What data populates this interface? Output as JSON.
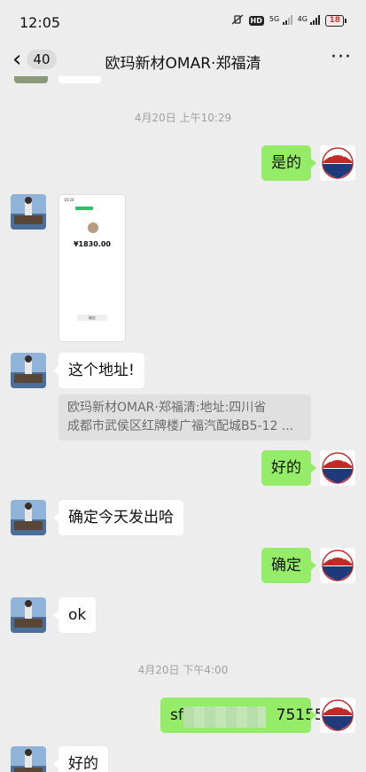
{
  "status_bar": {
    "time": "12:05",
    "hd": "HD",
    "net_a": "5G",
    "net_b": "4G",
    "battery": "18"
  },
  "nav": {
    "back_count": "40",
    "title": "欧玛新材OMAR·郑福清",
    "more": "···"
  },
  "timestamps": [
    "4月20日 上午10:29",
    "4月20日 下午4:00"
  ],
  "messages": {
    "m1": "是的",
    "image_amount": "¥1830.00",
    "image_button": "确定",
    "m3": "这个地址!",
    "quote_line1": "欧玛新材OMAR·郑福清:地址:四川省",
    "quote_line2": "成都市武侯区红牌楼广福汽配城B5-12 ...",
    "m4": "好的",
    "m5": "确定今天发出哈",
    "m6": "确定",
    "m7": "ok",
    "m8_prefix": "sf",
    "m8_suffix": "75155",
    "m9": "好的"
  },
  "colors": {
    "background": "#ededed",
    "outgoing_bubble": "#95ec69",
    "incoming_bubble": "#ffffff",
    "battery_low": "#e0342f"
  }
}
